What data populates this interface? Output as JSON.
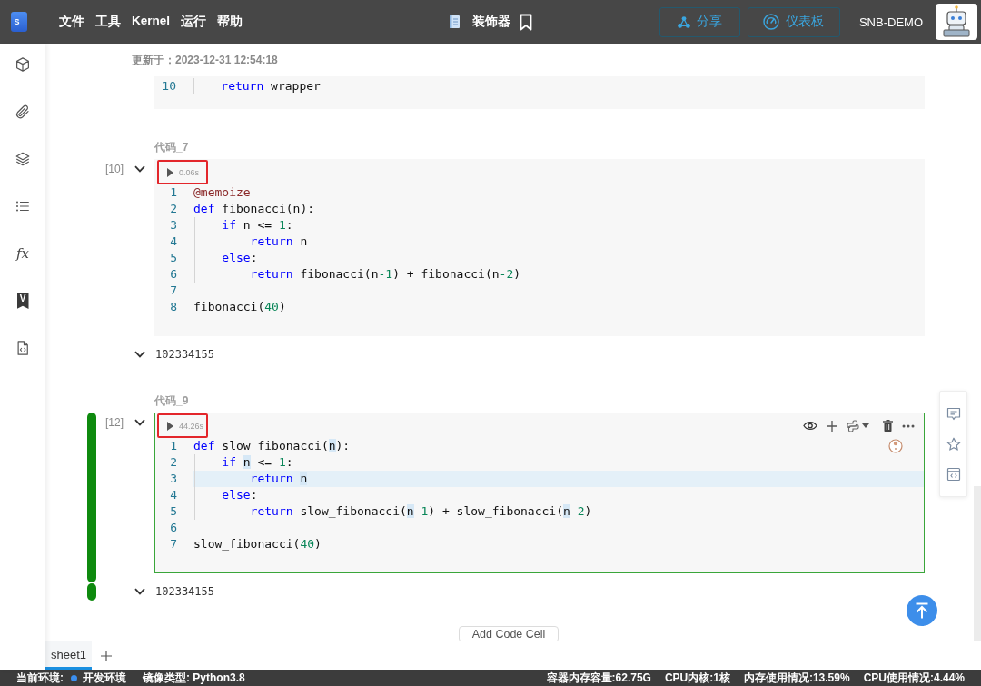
{
  "header": {
    "logo": "S_",
    "menu": [
      "文件",
      "工具",
      "Kernel",
      "运行",
      "帮助"
    ],
    "title": "装饰器",
    "buttons": [
      {
        "kind": "share",
        "label": "分享"
      },
      {
        "kind": "dashboard",
        "label": "仪表板"
      }
    ],
    "user": "SNB-DEMO"
  },
  "sidebar": {
    "items": [
      {
        "kind": "cube"
      },
      {
        "kind": "clip"
      },
      {
        "kind": "layers"
      },
      {
        "kind": "list"
      },
      {
        "kind": "formula",
        "label": "fx"
      },
      {
        "kind": "badge",
        "label": "V"
      },
      {
        "kind": "code-file"
      }
    ]
  },
  "notebook": {
    "updated": "更新于：2023-12-31 12:54:18",
    "previous_cell": {
      "lines": [
        {
          "number": "10",
          "current": false,
          "tokens": [
            {
              "kind": "keyword",
              "text": "    return"
            },
            {
              "kind": "plain",
              "text": " wrapper"
            }
          ]
        }
      ]
    },
    "cells": [
      {
        "label": "代码_7",
        "count": "[10]",
        "run_time": "0.06s",
        "annotated": true,
        "active": false,
        "lines": [
          {
            "number": "1",
            "current": false,
            "tokens": [
              {
                "kind": "decorator",
                "text": "@memoize"
              }
            ]
          },
          {
            "number": "2",
            "current": false,
            "tokens": [
              {
                "kind": "keyword",
                "text": "def"
              },
              {
                "kind": "plain",
                "text": " fibonacci(n):"
              }
            ]
          },
          {
            "number": "3",
            "current": false,
            "tokens": [
              {
                "kind": "keyword",
                "text": "    if"
              },
              {
                "kind": "plain",
                "text": " n <= "
              },
              {
                "kind": "number",
                "text": "1"
              },
              {
                "kind": "plain",
                "text": ":"
              }
            ]
          },
          {
            "number": "4",
            "current": false,
            "tokens": [
              {
                "kind": "keyword",
                "text": "        return"
              },
              {
                "kind": "plain",
                "text": " n"
              }
            ]
          },
          {
            "number": "5",
            "current": false,
            "tokens": [
              {
                "kind": "keyword",
                "text": "    else"
              },
              {
                "kind": "plain",
                "text": ":"
              }
            ]
          },
          {
            "number": "6",
            "current": false,
            "tokens": [
              {
                "kind": "keyword",
                "text": "        return"
              },
              {
                "kind": "plain",
                "text": " fibonacci(n"
              },
              {
                "kind": "number",
                "text": "-1"
              },
              {
                "kind": "plain",
                "text": ") + fibonacci(n"
              },
              {
                "kind": "number",
                "text": "-2"
              },
              {
                "kind": "plain",
                "text": ")"
              }
            ]
          },
          {
            "number": "7",
            "current": false
          },
          {
            "number": "8",
            "current": false,
            "tokens": [
              {
                "kind": "plain",
                "text": "fibonacci("
              },
              {
                "kind": "number",
                "text": "40"
              },
              {
                "kind": "plain",
                "text": ")"
              }
            ]
          }
        ],
        "output": "102334155"
      },
      {
        "label": "代码_9",
        "count": "[12]",
        "run_time": "44.26s",
        "annotated": true,
        "active": true,
        "lines": [
          {
            "number": "1",
            "current": false,
            "tokens": [
              {
                "kind": "keyword",
                "text": "def"
              },
              {
                "kind": "plain",
                "text": " slow_fibonacci("
              },
              {
                "kind": "match",
                "text": "n"
              },
              {
                "kind": "plain",
                "text": "):"
              }
            ]
          },
          {
            "number": "2",
            "current": false,
            "tokens": [
              {
                "kind": "keyword",
                "text": "    if "
              },
              {
                "kind": "match",
                "text": "n"
              },
              {
                "kind": "plain",
                "text": " <= "
              },
              {
                "kind": "number",
                "text": "1"
              },
              {
                "kind": "plain",
                "text": ":"
              }
            ]
          },
          {
            "number": "3",
            "current": true,
            "tokens": [
              {
                "kind": "keyword",
                "text": "        return "
              },
              {
                "kind": "match",
                "text": "n"
              }
            ]
          },
          {
            "number": "4",
            "current": false,
            "tokens": [
              {
                "kind": "keyword",
                "text": "    else"
              },
              {
                "kind": "plain",
                "text": ":"
              }
            ]
          },
          {
            "number": "5",
            "current": false,
            "tokens": [
              {
                "kind": "keyword",
                "text": "        return"
              },
              {
                "kind": "plain",
                "text": " slow_fibonacci("
              },
              {
                "kind": "match",
                "text": "n"
              },
              {
                "kind": "number",
                "text": "-1"
              },
              {
                "kind": "plain",
                "text": ") + slow_fibonacci("
              },
              {
                "kind": "match",
                "text": "n"
              },
              {
                "kind": "number",
                "text": "-2"
              },
              {
                "kind": "plain",
                "text": ")"
              }
            ]
          },
          {
            "number": "6",
            "current": false
          },
          {
            "number": "7",
            "current": false,
            "tokens": [
              {
                "kind": "plain",
                "text": "slow_fibonacci("
              },
              {
                "kind": "number",
                "text": "40"
              },
              {
                "kind": "plain",
                "text": ")"
              }
            ]
          }
        ],
        "output": "102334155"
      }
    ],
    "add_cell_button": "Add Code Cell"
  },
  "sheets": [
    {
      "label": "sheet1",
      "selected": true
    }
  ],
  "status_bar": {
    "environment": {
      "label": "当前环境:",
      "value": "开发环境",
      "color": "#3b8ff0"
    },
    "image": "镜像类型: Python3.8",
    "metrics": [
      "容器内存容量:62.75G",
      "CPU内核:1核",
      "内存使用情况:13.59%",
      "CPU使用情况:4.44%"
    ]
  }
}
